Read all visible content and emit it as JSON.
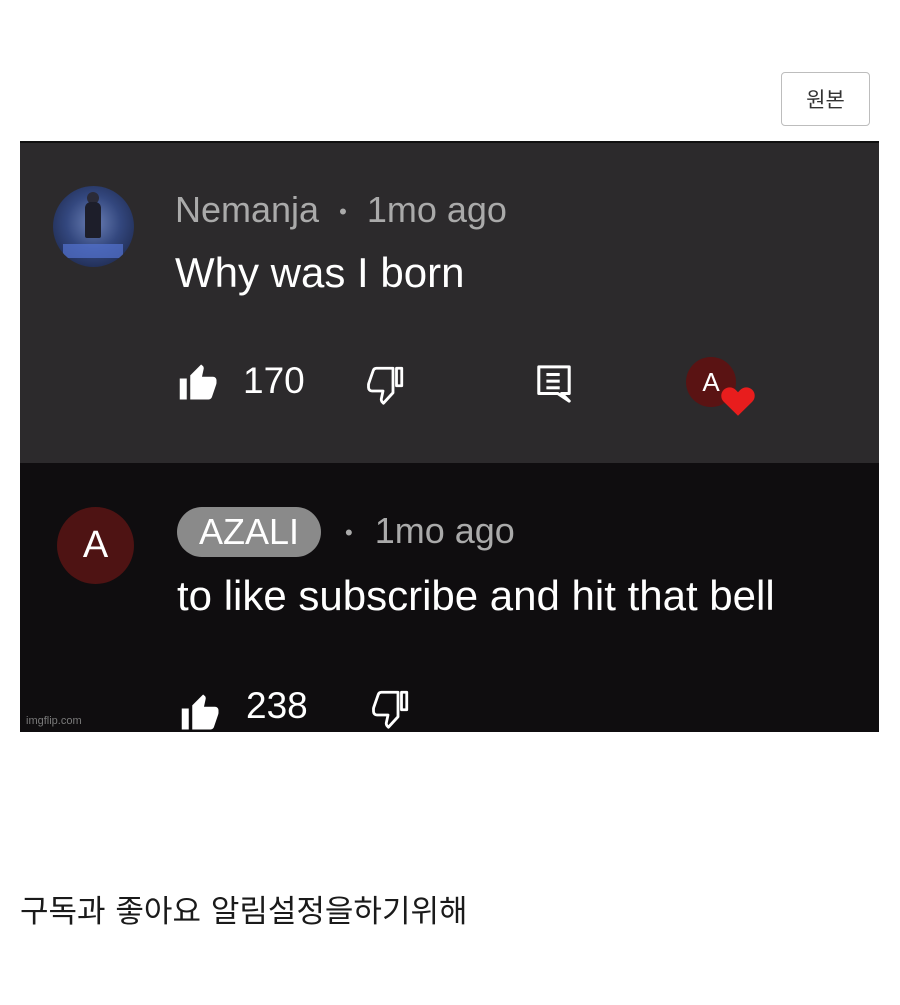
{
  "header": {
    "original_button_label": "원본"
  },
  "meme": {
    "comment1": {
      "author": "Nemanja",
      "separator": "•",
      "time": "1mo ago",
      "text": "Why was I born",
      "like_count": "170",
      "creator_heart_avatar_letter": "A"
    },
    "comment2": {
      "avatar_letter": "A",
      "author": "AZALI",
      "separator": "•",
      "time": "1mo ago",
      "text": "to like subscribe and hit that bell",
      "like_count": "238"
    },
    "watermark": "imgflip.com"
  },
  "caption": "구독과 좋아요 알림설정을하기위해",
  "colors": {
    "comment1_bg": "#2c2a2c",
    "comment2_bg": "#0f0d0f",
    "heart": "#e81d1d",
    "avatar_red": "#4e1313"
  },
  "icons": [
    "thumbs-up-icon",
    "thumbs-down-icon",
    "reply-icon",
    "heart-icon"
  ]
}
